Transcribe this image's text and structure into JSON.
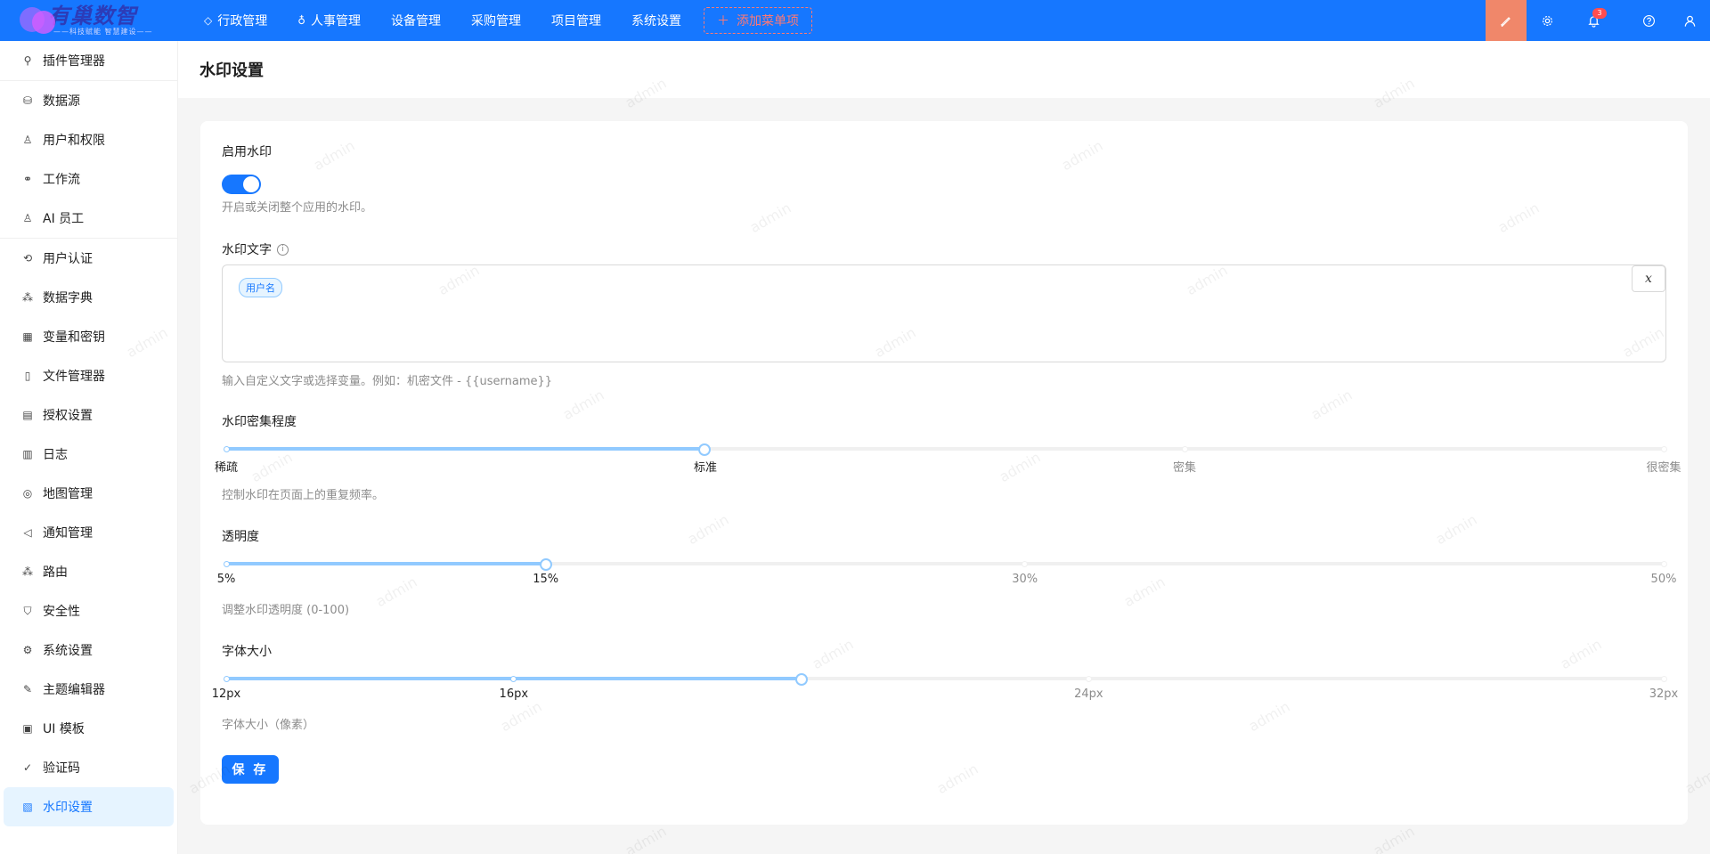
{
  "brand": {
    "title": "有巢数智",
    "slogan": "——科技赋能 智慧建设——"
  },
  "topnav": [
    {
      "label": "行政管理",
      "icon": "diamond-icon"
    },
    {
      "label": "人事管理",
      "icon": "lightbulb-icon"
    },
    {
      "label": "设备管理"
    },
    {
      "label": "采购管理"
    },
    {
      "label": "项目管理"
    },
    {
      "label": "系统设置"
    }
  ],
  "add_menu_label": "添加菜单项",
  "notification_count": "3",
  "sidebar": [
    {
      "label": "插件管理器",
      "icon": "plugin-icon"
    },
    {
      "label": "数据源",
      "icon": "database-icon"
    },
    {
      "label": "用户和权限",
      "icon": "user-permission-icon"
    },
    {
      "label": "工作流",
      "icon": "workflow-icon"
    },
    {
      "label": "AI 员工",
      "icon": "ai-employee-icon"
    },
    {
      "label": "用户认证",
      "icon": "login-icon"
    },
    {
      "label": "数据字典",
      "icon": "dictionary-icon"
    },
    {
      "label": "变量和密钥",
      "icon": "table-icon"
    },
    {
      "label": "文件管理器",
      "icon": "file-icon"
    },
    {
      "label": "授权设置",
      "icon": "license-icon"
    },
    {
      "label": "日志",
      "icon": "log-icon"
    },
    {
      "label": "地图管理",
      "icon": "map-pin-icon"
    },
    {
      "label": "通知管理",
      "icon": "megaphone-icon"
    },
    {
      "label": "路由",
      "icon": "route-icon"
    },
    {
      "label": "安全性",
      "icon": "shield-icon"
    },
    {
      "label": "系统设置",
      "icon": "gear-icon"
    },
    {
      "label": "主题编辑器",
      "icon": "theme-icon"
    },
    {
      "label": "UI 模板",
      "icon": "template-icon"
    },
    {
      "label": "验证码",
      "icon": "check-circle-icon"
    },
    {
      "label": "水印设置",
      "icon": "watermark-icon",
      "active": true
    }
  ],
  "page_title": "水印设置",
  "form": {
    "enable": {
      "label": "启用水印",
      "value": true,
      "help": "开启或关闭整个应用的水印。"
    },
    "text": {
      "label": "水印文字",
      "tag": "用户名",
      "variable_button": "x",
      "help": "输入自定义文字或选择变量。例如：机密文件 - {{username}}"
    },
    "density": {
      "label": "水印密集程度",
      "marks": [
        "稀疏",
        "标准",
        "密集",
        "很密集"
      ],
      "value_fraction": 0.333,
      "help": "控制水印在页面上的重复频率。"
    },
    "opacity": {
      "label": "透明度",
      "marks": [
        "5%",
        "15%",
        "30%",
        "50%"
      ],
      "min": 5,
      "max": 50,
      "value": 15,
      "help": "调整水印透明度 (0-100)"
    },
    "font_size": {
      "label": "字体大小",
      "marks": [
        "12px",
        "16px",
        "24px",
        "32px"
      ],
      "min": 12,
      "max": 32,
      "value": 20,
      "help": "字体大小（像素）"
    },
    "save_label": "保 存"
  },
  "watermark_text": "admin",
  "colors": {
    "primary": "#1677ff",
    "active_tool": "#f0876a",
    "danger": "#ff4d4f"
  }
}
